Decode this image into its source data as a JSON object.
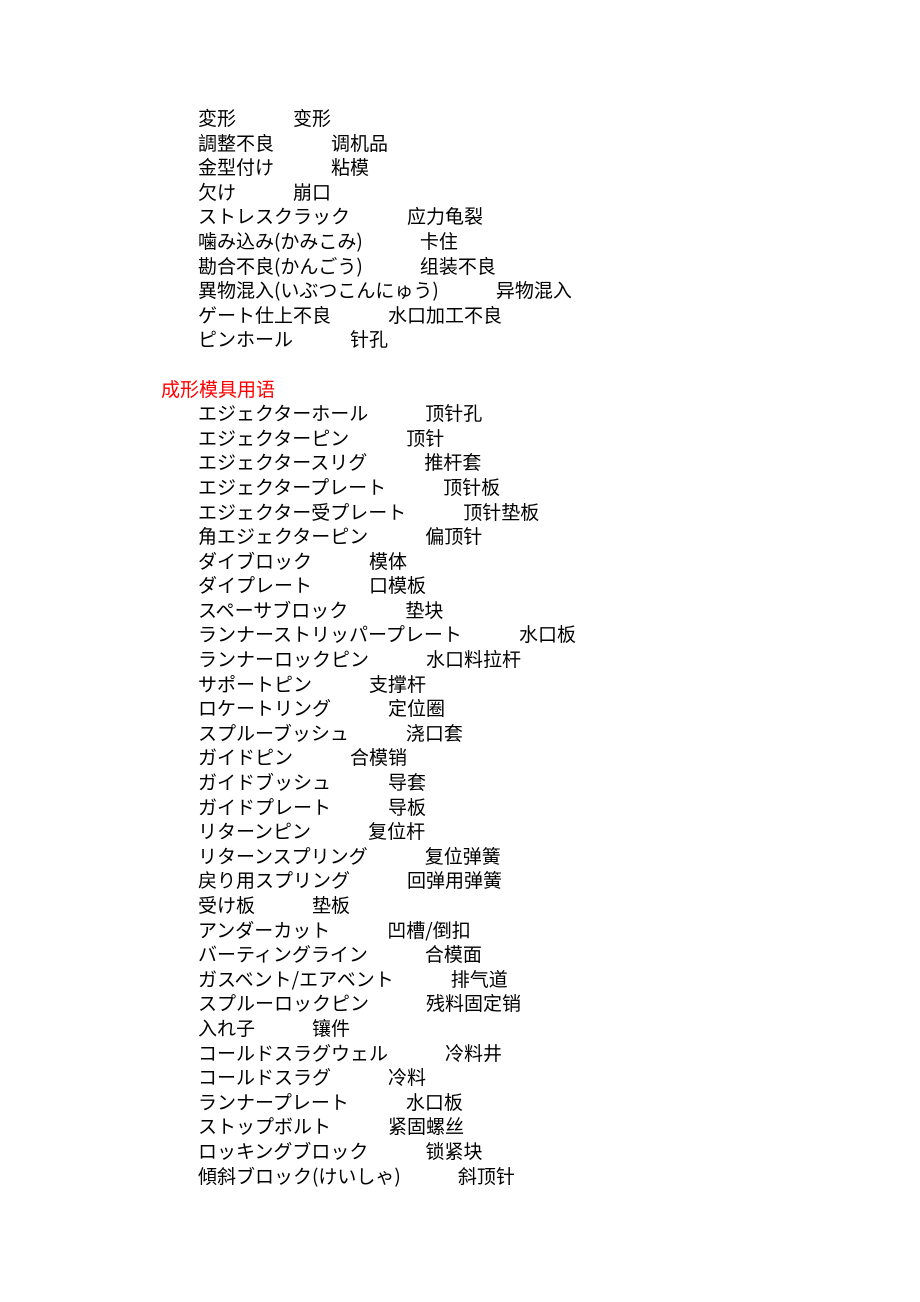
{
  "section1": [
    {
      "jp": "変形",
      "cn": "变形"
    },
    {
      "jp": "調整不良",
      "cn": "调机品"
    },
    {
      "jp": "金型付け",
      "cn": "粘模"
    },
    {
      "jp": "欠け",
      "cn": "崩口"
    },
    {
      "jp": "ストレスクラック",
      "cn": "应力龟裂"
    },
    {
      "jp": "噛み込み(かみこみ)",
      "cn": "卡住"
    },
    {
      "jp": "勘合不良(かんごう)",
      "cn": "组装不良"
    },
    {
      "jp": "異物混入(いぶつこんにゅう)",
      "cn": "异物混入"
    },
    {
      "jp": "ゲート仕上不良",
      "cn": "水口加工不良"
    },
    {
      "jp": "ピンホール",
      "cn": "针孔"
    }
  ],
  "section2_heading": "成形模具用语",
  "section2": [
    {
      "jp": "エジェクターホール",
      "cn": "顶针孔"
    },
    {
      "jp": "エジェクターピン",
      "cn": "顶针"
    },
    {
      "jp": "エジェクタースリグ",
      "cn": "推杆套"
    },
    {
      "jp": "エジェクタープレート",
      "cn": "顶针板"
    },
    {
      "jp": "エジェクター受プレート",
      "cn": "顶针垫板"
    },
    {
      "jp": "角エジェクターピン",
      "cn": "偏顶针"
    },
    {
      "jp": "ダイブロック",
      "cn": "模体"
    },
    {
      "jp": "ダイプレート",
      "cn": "口模板"
    },
    {
      "jp": "スペーサブロック",
      "cn": "垫块"
    },
    {
      "jp": "ランナーストリッパープレート",
      "cn": "水口板"
    },
    {
      "jp": "ランナーロックピン",
      "cn": "水口料拉杆"
    },
    {
      "jp": "サポートピン",
      "cn": "支撑杆"
    },
    {
      "jp": "ロケートリング",
      "cn": "定位圈"
    },
    {
      "jp": "スプルーブッシュ",
      "cn": "浇口套"
    },
    {
      "jp": "ガイドピン",
      "cn": "合模销"
    },
    {
      "jp": "ガイドブッシュ",
      "cn": "导套"
    },
    {
      "jp": "ガイドプレート",
      "cn": "导板"
    },
    {
      "jp": "リターンピン",
      "cn": "复位杆"
    },
    {
      "jp": "リターンスプリング",
      "cn": "复位弹簧"
    },
    {
      "jp": "戻り用スプリング",
      "cn": "回弹用弹簧"
    },
    {
      "jp": "受け板",
      "cn": "垫板"
    },
    {
      "jp": "アンダーカット",
      "cn": "凹槽/倒扣"
    },
    {
      "jp": "バーティングライン",
      "cn": "合模面"
    },
    {
      "jp": "ガスベント/エアベント",
      "cn": "排气道"
    },
    {
      "jp": "スプルーロックピン",
      "cn": "残料固定销"
    },
    {
      "jp": "入れ子",
      "cn": "镶件"
    },
    {
      "jp": "コールドスラグウェル",
      "cn": "冷料井"
    },
    {
      "jp": "コールドスラグ",
      "cn": "冷料"
    },
    {
      "jp": "ランナープレート",
      "cn": "水口板"
    },
    {
      "jp": "ストップボルト",
      "cn": "紧固螺丝"
    },
    {
      "jp": "ロッキングブロック",
      "cn": "锁紧块"
    },
    {
      "jp": "傾斜ブロック(けいしゃ)",
      "cn": "斜顶针"
    }
  ]
}
